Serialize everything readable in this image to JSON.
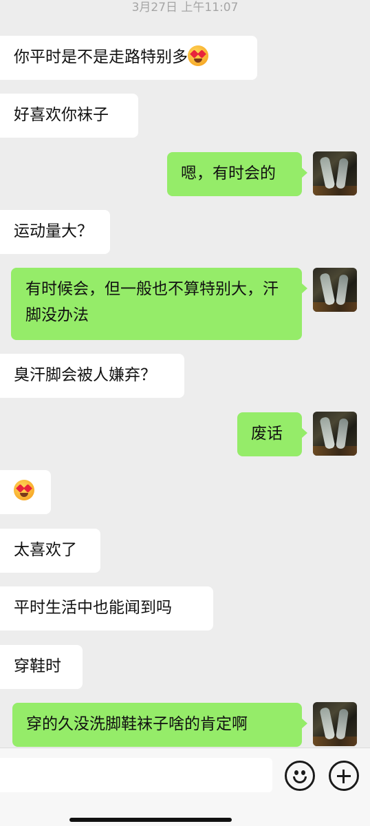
{
  "timestamp": "3月27日 上午11:07",
  "messages": [
    {
      "side": "in",
      "text": "你平时是不是走路特别多",
      "emoji": "heart-eyes-drool"
    },
    {
      "side": "in",
      "text": "好喜欢你袜子"
    },
    {
      "side": "out",
      "text": "嗯，有时会的"
    },
    {
      "side": "in",
      "text": "运动量大？"
    },
    {
      "side": "out",
      "text": "有时候会，但一般也不算特别大，汗脚没办法"
    },
    {
      "side": "in",
      "text": "臭汗脚会被人嫌弃？"
    },
    {
      "side": "out",
      "text": "废话"
    },
    {
      "side": "in",
      "text": "",
      "emoji": "heart-eyes-drool"
    },
    {
      "side": "in",
      "text": "太喜欢了"
    },
    {
      "side": "in",
      "text": "平时生活中也能闻到吗"
    },
    {
      "side": "in",
      "text": "穿鞋时"
    },
    {
      "side": "out",
      "text": "穿的久没洗脚鞋袜子啥的肯定啊"
    }
  ],
  "colors": {
    "background": "#ededed",
    "incoming_bubble": "#ffffff",
    "outgoing_bubble": "#95ec69",
    "timestamp": "#a5a5a5"
  },
  "input_bar": {
    "emoji_icon": "smiley-face-icon",
    "plus_icon": "plus-circle-icon"
  }
}
